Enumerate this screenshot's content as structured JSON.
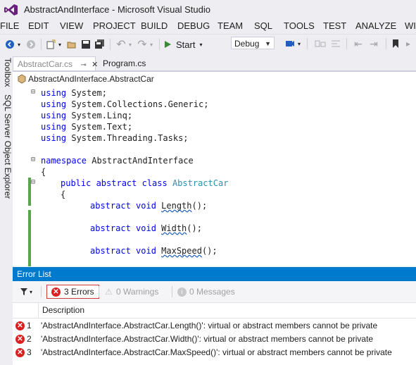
{
  "window": {
    "title": "AbstractAndInterface - Microsoft Visual Studio"
  },
  "menu": [
    "FILE",
    "EDIT",
    "VIEW",
    "PROJECT",
    "BUILD",
    "DEBUG",
    "TEAM",
    "SQL",
    "TOOLS",
    "TEST",
    "ANALYZE",
    "WI"
  ],
  "toolbar": {
    "start_label": "Start",
    "config_value": "Debug"
  },
  "side_tabs": [
    "Toolbox",
    "SQL Server Object Explorer"
  ],
  "doc_tabs": [
    {
      "label": "AbstractCar.cs",
      "active": true
    },
    {
      "label": "Program.cs",
      "active": false
    }
  ],
  "nav": {
    "class_path": "AbstractAndInterface.AbstractCar"
  },
  "code": {
    "u1_kw": "using",
    "u1_rest": " System;",
    "u2_kw": "using",
    "u2_rest": " System.Collections.Generic;",
    "u3_kw": "using",
    "u3_rest": " System.Linq;",
    "u4_kw": "using",
    "u4_rest": " System.Text;",
    "u5_kw": "using",
    "u5_rest": " System.Threading.Tasks;",
    "ns_kw": "namespace",
    "ns_name": " AbstractAndInterface",
    "brace_open1": "{",
    "cls_kw": "public abstract class",
    "cls_name": "AbstractCar",
    "brace_open2": "{",
    "m1_kw": "abstract void",
    "m1_name": "Length",
    "m1_tail": "();",
    "m2_kw": "abstract void",
    "m2_name": "Width",
    "m2_tail": "();",
    "m3_kw": "abstract void",
    "m3_name": "MaxSpeed",
    "m3_tail": "();"
  },
  "error_list": {
    "title": "Error List",
    "errors_label": "3 Errors",
    "warnings_label": "0 Warnings",
    "messages_label": "0 Messages",
    "column_description": "Description",
    "rows": [
      {
        "num": "1",
        "desc": "'AbstractAndInterface.AbstractCar.Length()': virtual or abstract members cannot be private"
      },
      {
        "num": "2",
        "desc": "'AbstractAndInterface.AbstractCar.Width()': virtual or abstract members cannot be private"
      },
      {
        "num": "3",
        "desc": "'AbstractAndInterface.AbstractCar.MaxSpeed()': virtual or abstract members cannot be private"
      }
    ]
  },
  "colors": {
    "accent": "#007acc",
    "keyword": "#0000ff",
    "type": "#2b91af",
    "error": "#d92121",
    "change_bar": "#57a64a"
  }
}
